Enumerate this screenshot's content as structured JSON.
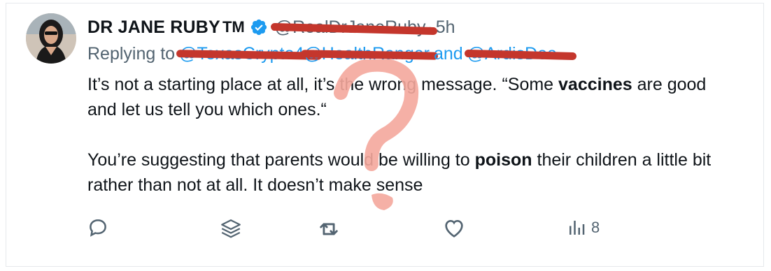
{
  "author": {
    "name": "DR JANE RUBY",
    "trademark": "TM",
    "handle": "@RealDrJaneRuby",
    "separator": "·",
    "time": "5h",
    "verified_icon": "verified-badge-icon",
    "verified_color": "#1d9bf0"
  },
  "reply": {
    "prefix": "Replying to",
    "mentions": [
      "@TexasCrypto4",
      "@HealthRanger"
    ],
    "and": "and",
    "last_mention": "@ArdisDee"
  },
  "tweet": {
    "line1_a": "It’s not a starting place at all, it’s the wrong message. “Some ",
    "line1_bold": "vaccines",
    "line1_b": " are good and let us tell you which ones.“",
    "line2_a": "You’re suggesting that parents would be willing to ",
    "line2_bold": "poison",
    "line2_b": " their children a little bit rather than not at all. It doesn’t make sense"
  },
  "actions": {
    "reply_icon": "reply-icon",
    "stack_icon": "layers-icon",
    "retweet_icon": "retweet-icon",
    "like_icon": "heart-icon",
    "views_icon": "views-icon",
    "views_count": "8"
  },
  "colors": {
    "redaction": "#c4362c",
    "annotation": "#f4a79c",
    "link": "#1d9bf0",
    "muted": "#536471"
  }
}
